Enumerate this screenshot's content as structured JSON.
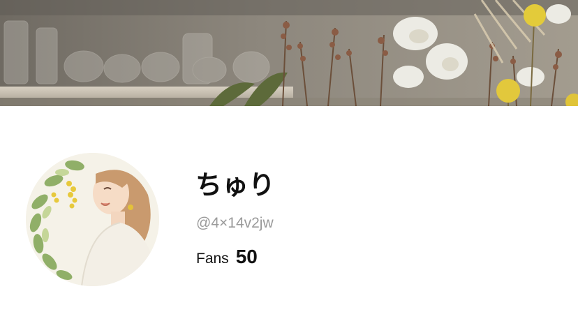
{
  "profile": {
    "display_name": "ちゅり",
    "handle": "@4×14v2jw",
    "fans_label": "Fans",
    "fans_count": "50"
  },
  "colors": {
    "background": "#ffffff",
    "name_text": "#111111",
    "handle_text": "#9a9a9a"
  }
}
